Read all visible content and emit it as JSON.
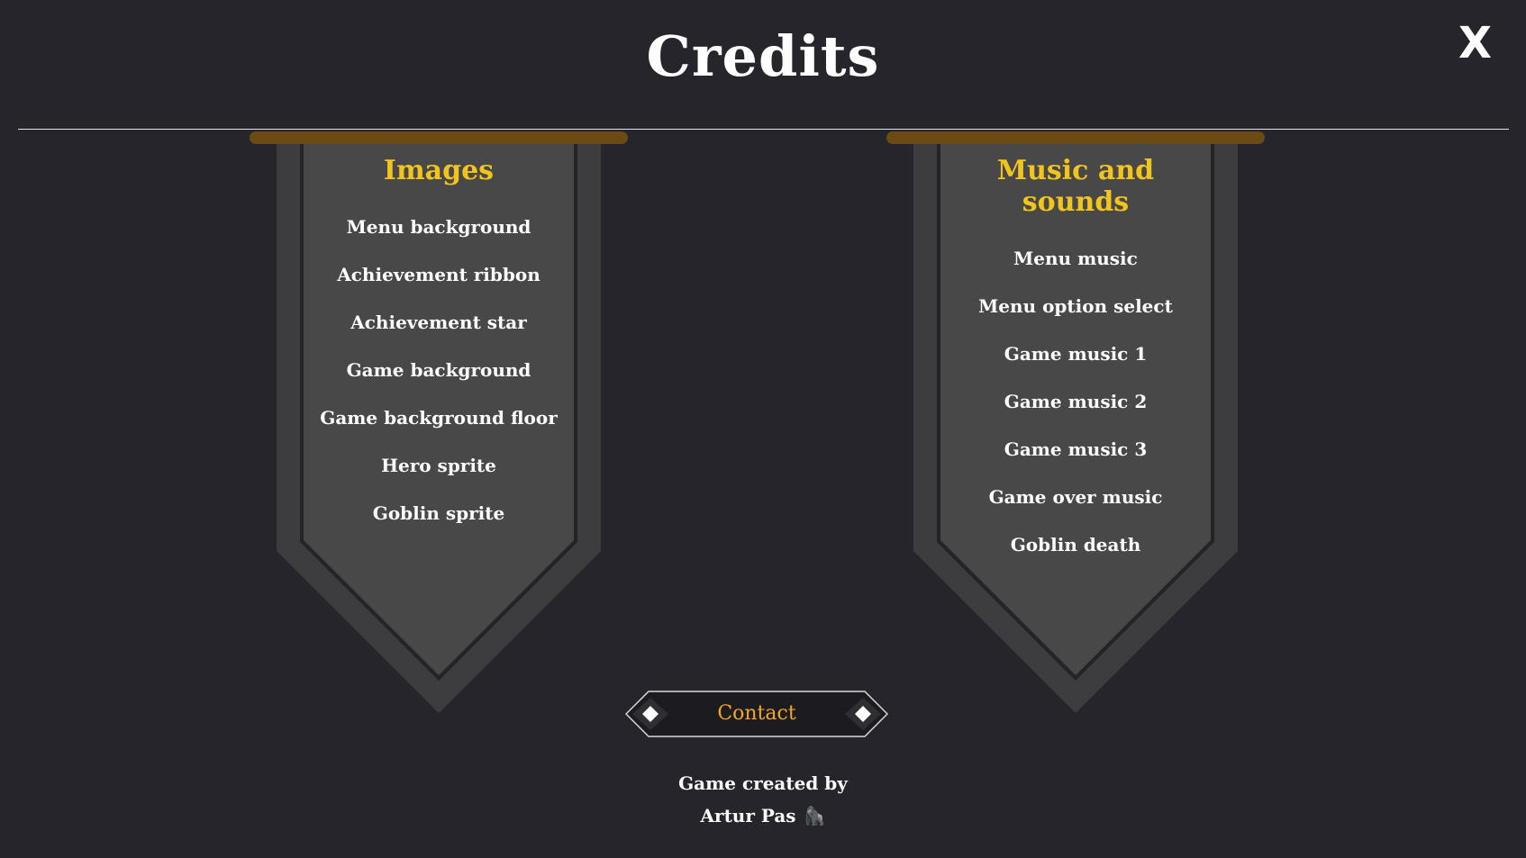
{
  "title": "Credits",
  "close_label": "X",
  "banners": [
    {
      "heading": "Images",
      "items": [
        "Menu background",
        "Achievement ribbon",
        "Achievement star",
        "Game background",
        "Game background floor",
        "Hero sprite",
        "Goblin sprite"
      ]
    },
    {
      "heading": "Music and sounds",
      "items": [
        "Menu music",
        "Menu option select",
        "Game music 1",
        "Game music 2",
        "Game music 3",
        "Game over music",
        "Goblin death"
      ]
    }
  ],
  "contact_label": "Contact",
  "footer": {
    "line1": "Game created by",
    "line2": "Artur Pas",
    "icon": "gorilla-icon"
  },
  "colors": {
    "background": "#25252b",
    "banner_outer": "#3d3d40",
    "banner_inner": "#484849",
    "rod": "#6b4a14",
    "heading": "#f2c51e",
    "contact_text": "#f5a623"
  }
}
